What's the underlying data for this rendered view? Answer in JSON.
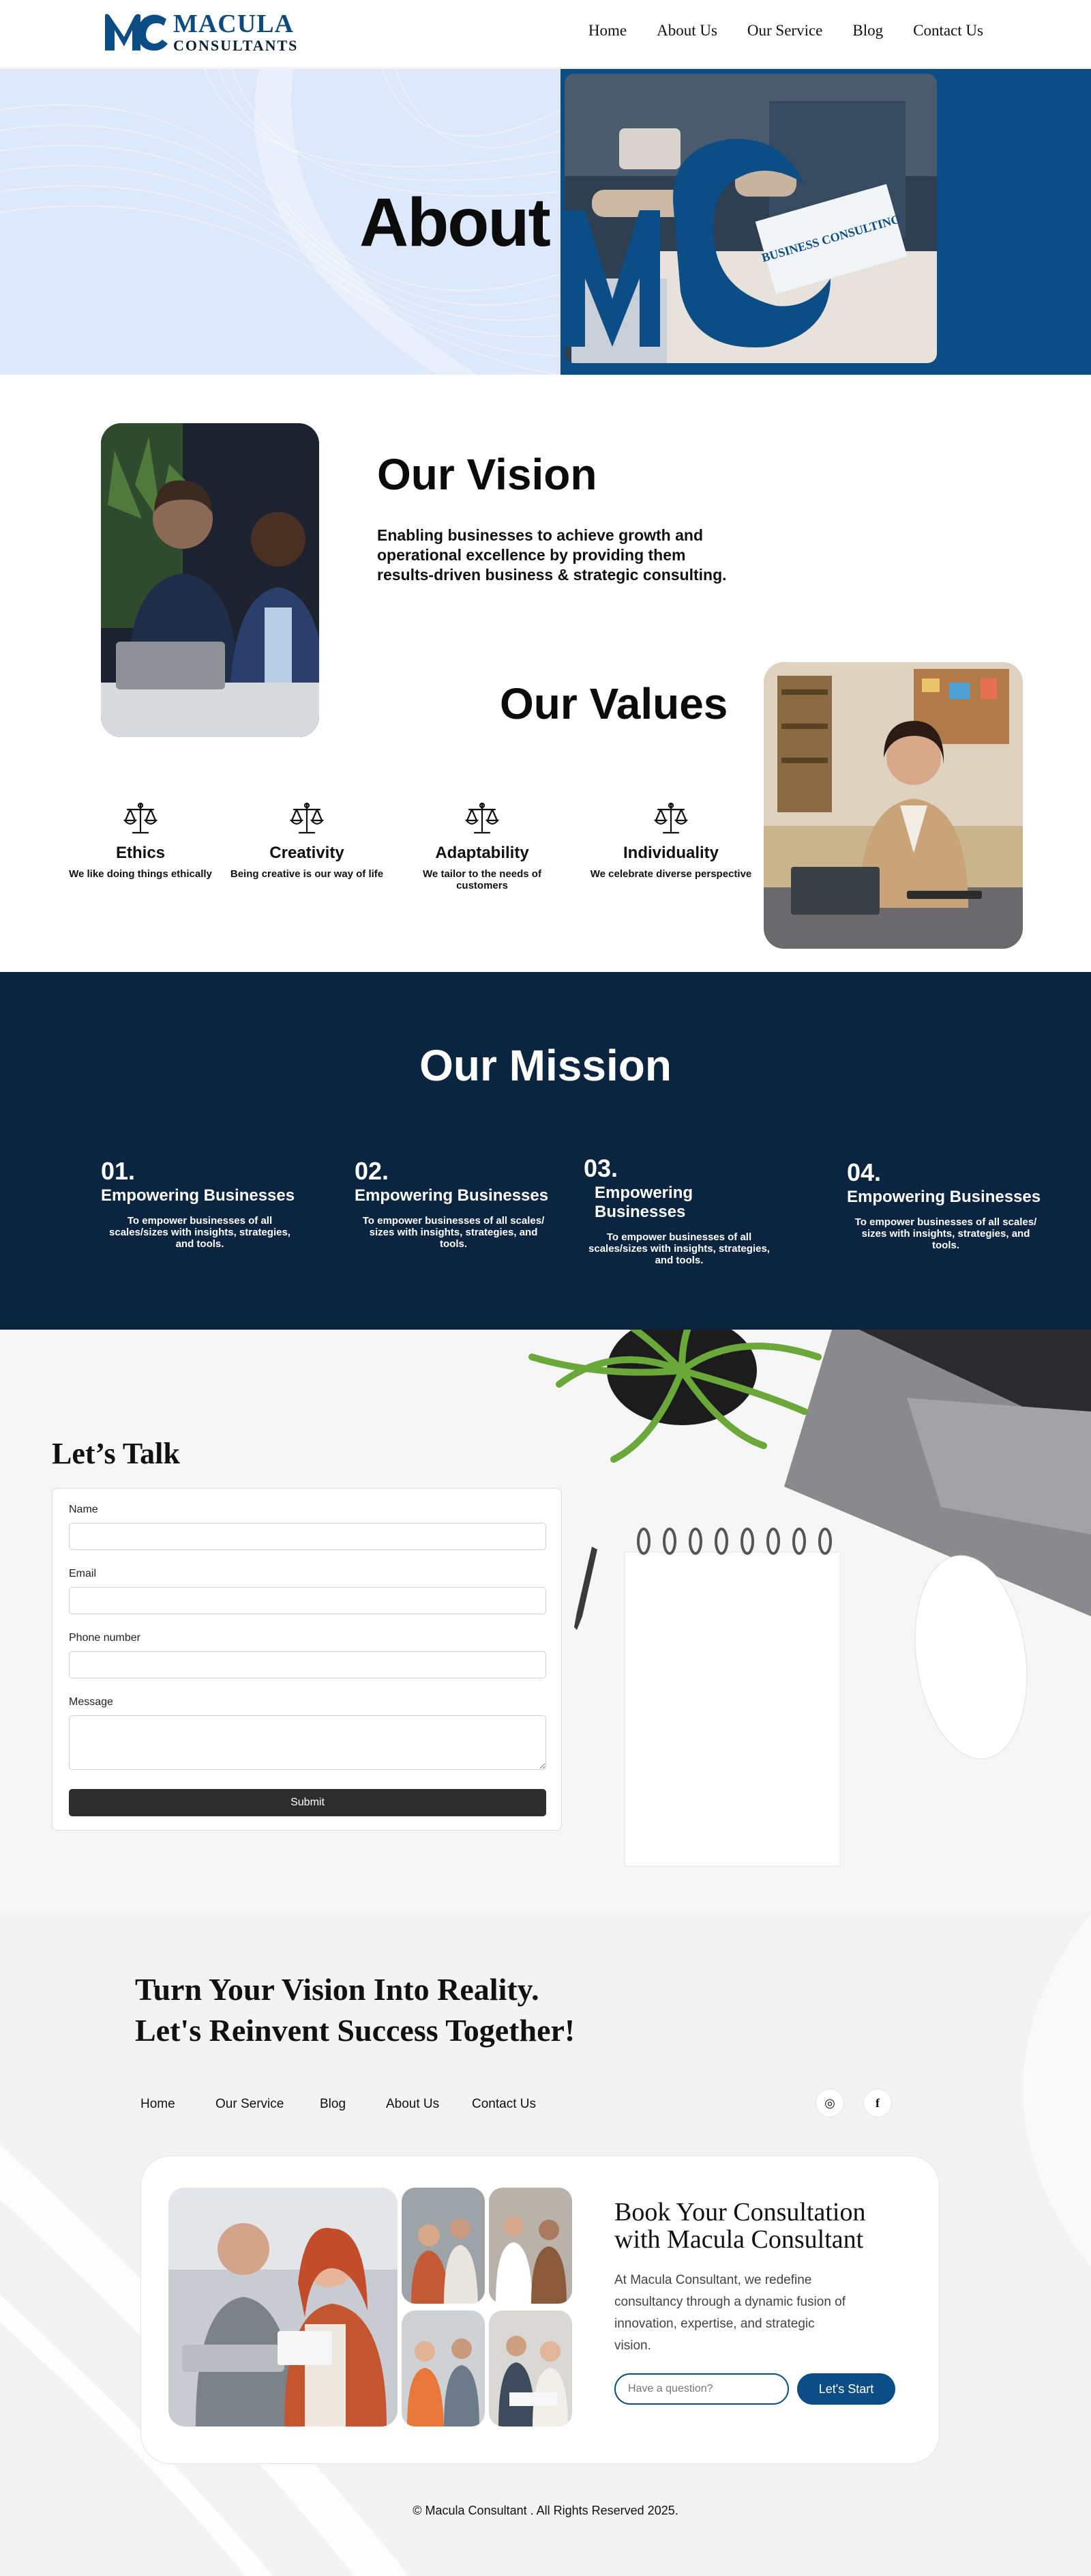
{
  "header": {
    "logo": {
      "line1": "MACULA",
      "line2": "CONSULTANTS"
    },
    "nav": [
      "Home",
      "About Us",
      "Our Service",
      "Blog",
      "Contact Us"
    ]
  },
  "hero": {
    "title": "About",
    "photo_caption": "BUSINESS CONSULTING"
  },
  "vision": {
    "title": "Our Vision",
    "text": "Enabling businesses to achieve growth and operational excellence by providing them results-driven business  & strategic consulting."
  },
  "values": {
    "title": "Our Values",
    "items": [
      {
        "name": "Ethics",
        "desc": "We like doing things ethically",
        "icon": "scales-icon"
      },
      {
        "name": "Creativity",
        "desc": "Being creative is our way of life",
        "icon": "scales-icon"
      },
      {
        "name": "Adaptability",
        "desc": "We tailor to the needs of customers",
        "icon": "scales-icon"
      },
      {
        "name": "Individuality",
        "desc": "We celebrate diverse perspective",
        "icon": "scales-icon"
      }
    ]
  },
  "mission": {
    "title": "Our Mission",
    "items": [
      {
        "num": "01.",
        "heading": "Empowering Businesses",
        "desc": "To empower businesses of all scales/sizes with insights, strategies, and tools."
      },
      {
        "num": "02.",
        "heading": "Empowering Businesses",
        "desc": "To empower businesses of all scales/ sizes with insights, strategies, and tools."
      },
      {
        "num": "03.",
        "heading": "Empowering Businesses",
        "desc": "To empower businesses of all scales/sizes with insights, strategies, and tools."
      },
      {
        "num": "04.",
        "heading": "Empowering Businesses",
        "desc": "To empower businesses of all scales/ sizes with insights, strategies, and tools."
      }
    ]
  },
  "contact": {
    "title": "Let’s Talk",
    "fields": [
      {
        "label": "Name",
        "value": ""
      },
      {
        "label": "Email",
        "value": ""
      },
      {
        "label": "Phone number",
        "value": ""
      },
      {
        "label": "Message",
        "value": ""
      }
    ],
    "submit_label": "Submit"
  },
  "footer": {
    "cta_line1": "Turn Your Vision Into Reality.",
    "cta_line2": "Let's Reinvent Success Together!",
    "nav": [
      "Home",
      "Our Service",
      "Blog",
      "About Us",
      "Contact Us"
    ],
    "social": [
      {
        "name": "instagram-icon",
        "glyph": "◎"
      },
      {
        "name": "facebook-icon",
        "glyph": "f"
      }
    ],
    "book": {
      "title": "Book Your Consultation with Macula Consultant",
      "text": "At Macula Consultant, we redefine consultancy through a dynamic fusion of innovation, expertise, and strategic vision.",
      "input_placeholder": "Have a question?",
      "button_label": "Let's Start"
    },
    "copyright": "© Macula Consultant . All Rights Reserved 2025."
  },
  "colors": {
    "brand_blue": "#0d4d85",
    "mission_navy": "#0b2540",
    "hero_bg": "#dde9fb"
  }
}
